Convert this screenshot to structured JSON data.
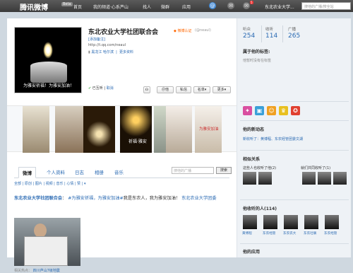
{
  "topbar": {
    "logo": "腾讯微博",
    "beta": "Beta",
    "nav": [
      "首页",
      "我的频道·心系芦山",
      "找人",
      "微群",
      "应用"
    ],
    "badges": {
      "at": "",
      "msg": "5"
    },
    "user": "东北农业大学...",
    "search_placeholder": "搜他的广播/搜全站"
  },
  "profile": {
    "avatar_caption": "为雅安祈福！为雅安加油！",
    "name": "东北农业大学社团联合会",
    "verified_label": "微博认证",
    "handle": "(@neaul)",
    "remark_link": "[添加备注]",
    "url": "http://t.qq.com/neaul",
    "location": "黑龙江 哈尔滨",
    "more_link": "更多资料",
    "listen_status": "已互听",
    "cancel": "取消",
    "buttons": {
      "at": "＠他",
      "message": "私信",
      "list": "名单▾",
      "more": "更多▾"
    }
  },
  "photos": [
    {
      "caption": ""
    },
    {
      "caption": ""
    },
    {
      "caption": ""
    },
    {
      "caption": "祈福·雅安"
    },
    {
      "caption": ""
    },
    {
      "caption": ""
    },
    {
      "caption": "为雅安加油"
    }
  ],
  "tabs": [
    "微博",
    "个人资料",
    "日志",
    "相册",
    "音乐"
  ],
  "tab_search": {
    "placeholder": "搜他的广播",
    "button": "搜索"
  },
  "filters": "全部 | 原创 | 图片 | 视频 | 音乐 | 心情 | 赞 | ▾",
  "post": {
    "author": "东北农业大学社团联合会",
    "tag1": "#为雅安祈福，为雅安加油#",
    "body": "我是东农人，我为雅安加油！",
    "tail": "东北农业大学团委"
  },
  "hot": {
    "label": "相关热点：",
    "link": "四川芦山7级地震"
  },
  "sidebar": {
    "stats": [
      {
        "label": "听众",
        "value": "254"
      },
      {
        "label": "收听",
        "value": "114"
      },
      {
        "label": "广播",
        "value": "265"
      }
    ],
    "tags_title": "属于他的标签:",
    "tags_note": "他暂时没有在标签",
    "news_title": "他的新动态",
    "news_item": "新收听了：黄博程、东农经管团委文湖",
    "relation_title": "相似关系",
    "relation_left": "这些人也收听了他(2)",
    "relation_right": "就们共同收听了(1)",
    "listeners_title": "他收听的人(114)",
    "listeners": [
      "黄博程",
      "东农经管",
      "东农农大",
      "东农社联",
      "东农经管"
    ],
    "apps_title": "他的应用"
  },
  "colors": {
    "accent": "#2a6ab3",
    "topbar": "#444444"
  }
}
